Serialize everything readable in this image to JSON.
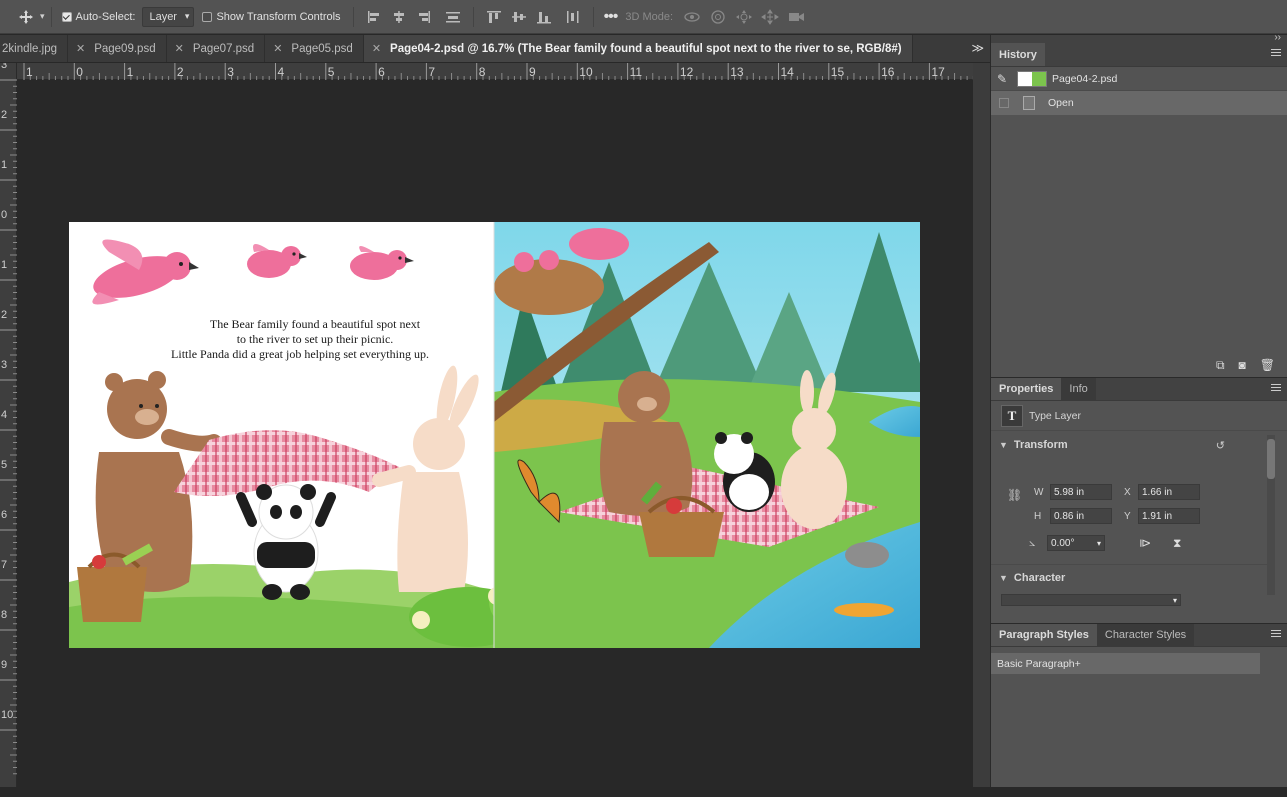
{
  "options_bar": {
    "auto_select_label": "Auto-Select:",
    "auto_select_value": "Layer",
    "show_transform_label": "Show Transform Controls",
    "mode_label": "3D Mode:"
  },
  "doc_tabs": [
    {
      "label": "2kindle.jpg",
      "active": false,
      "closable": false
    },
    {
      "label": "Page09.psd",
      "active": false,
      "closable": true
    },
    {
      "label": "Page07.psd",
      "active": false,
      "closable": true
    },
    {
      "label": "Page05.psd",
      "active": false,
      "closable": true
    },
    {
      "label": "Page04-2.psd @ 16.7% (The Bear family found a beautiful spot next  to the river to se, RGB/8#)",
      "active": true,
      "closable": true
    }
  ],
  "ruler": {
    "h_labels": [
      "1",
      "0",
      "1",
      "2",
      "3",
      "4",
      "5",
      "6",
      "7",
      "8",
      "9",
      "10",
      "11",
      "12",
      "13",
      "14",
      "15",
      "16",
      "17"
    ],
    "v_labels": [
      "3",
      "2",
      "1",
      "0",
      "1",
      "2",
      "3",
      "4",
      "5",
      "6",
      "7",
      "8",
      "9",
      "10"
    ]
  },
  "artwork": {
    "text_lines": [
      "The Bear family found a beautiful spot next",
      "to the river to set up their picnic.",
      "Little Panda did a great job helping set everything up."
    ],
    "sky_color": "#7fd7ea",
    "grass_color": "#7cc44d"
  },
  "history": {
    "title": "History",
    "snapshot": "Page04-2.psd",
    "steps": [
      "Open"
    ]
  },
  "properties": {
    "tab_properties": "Properties",
    "tab_info": "Info",
    "layer_type": "Type Layer",
    "transform_label": "Transform",
    "w_label": "W",
    "w_value": "5.98 in",
    "h_label": "H",
    "h_value": "0.86 in",
    "x_label": "X",
    "x_value": "1.66 in",
    "y_label": "Y",
    "y_value": "1.91 in",
    "angle_value": "0.00°",
    "character_label": "Character"
  },
  "styles": {
    "tab_paragraph": "Paragraph Styles",
    "tab_character": "Character Styles",
    "items": [
      "Basic Paragraph+"
    ]
  },
  "colors": {
    "ui_panel": "#535353",
    "ui_dark": "#282828",
    "pink_bird": "#ee6f9b",
    "bear": "#a97450",
    "bunny": "#f6dcc8"
  }
}
